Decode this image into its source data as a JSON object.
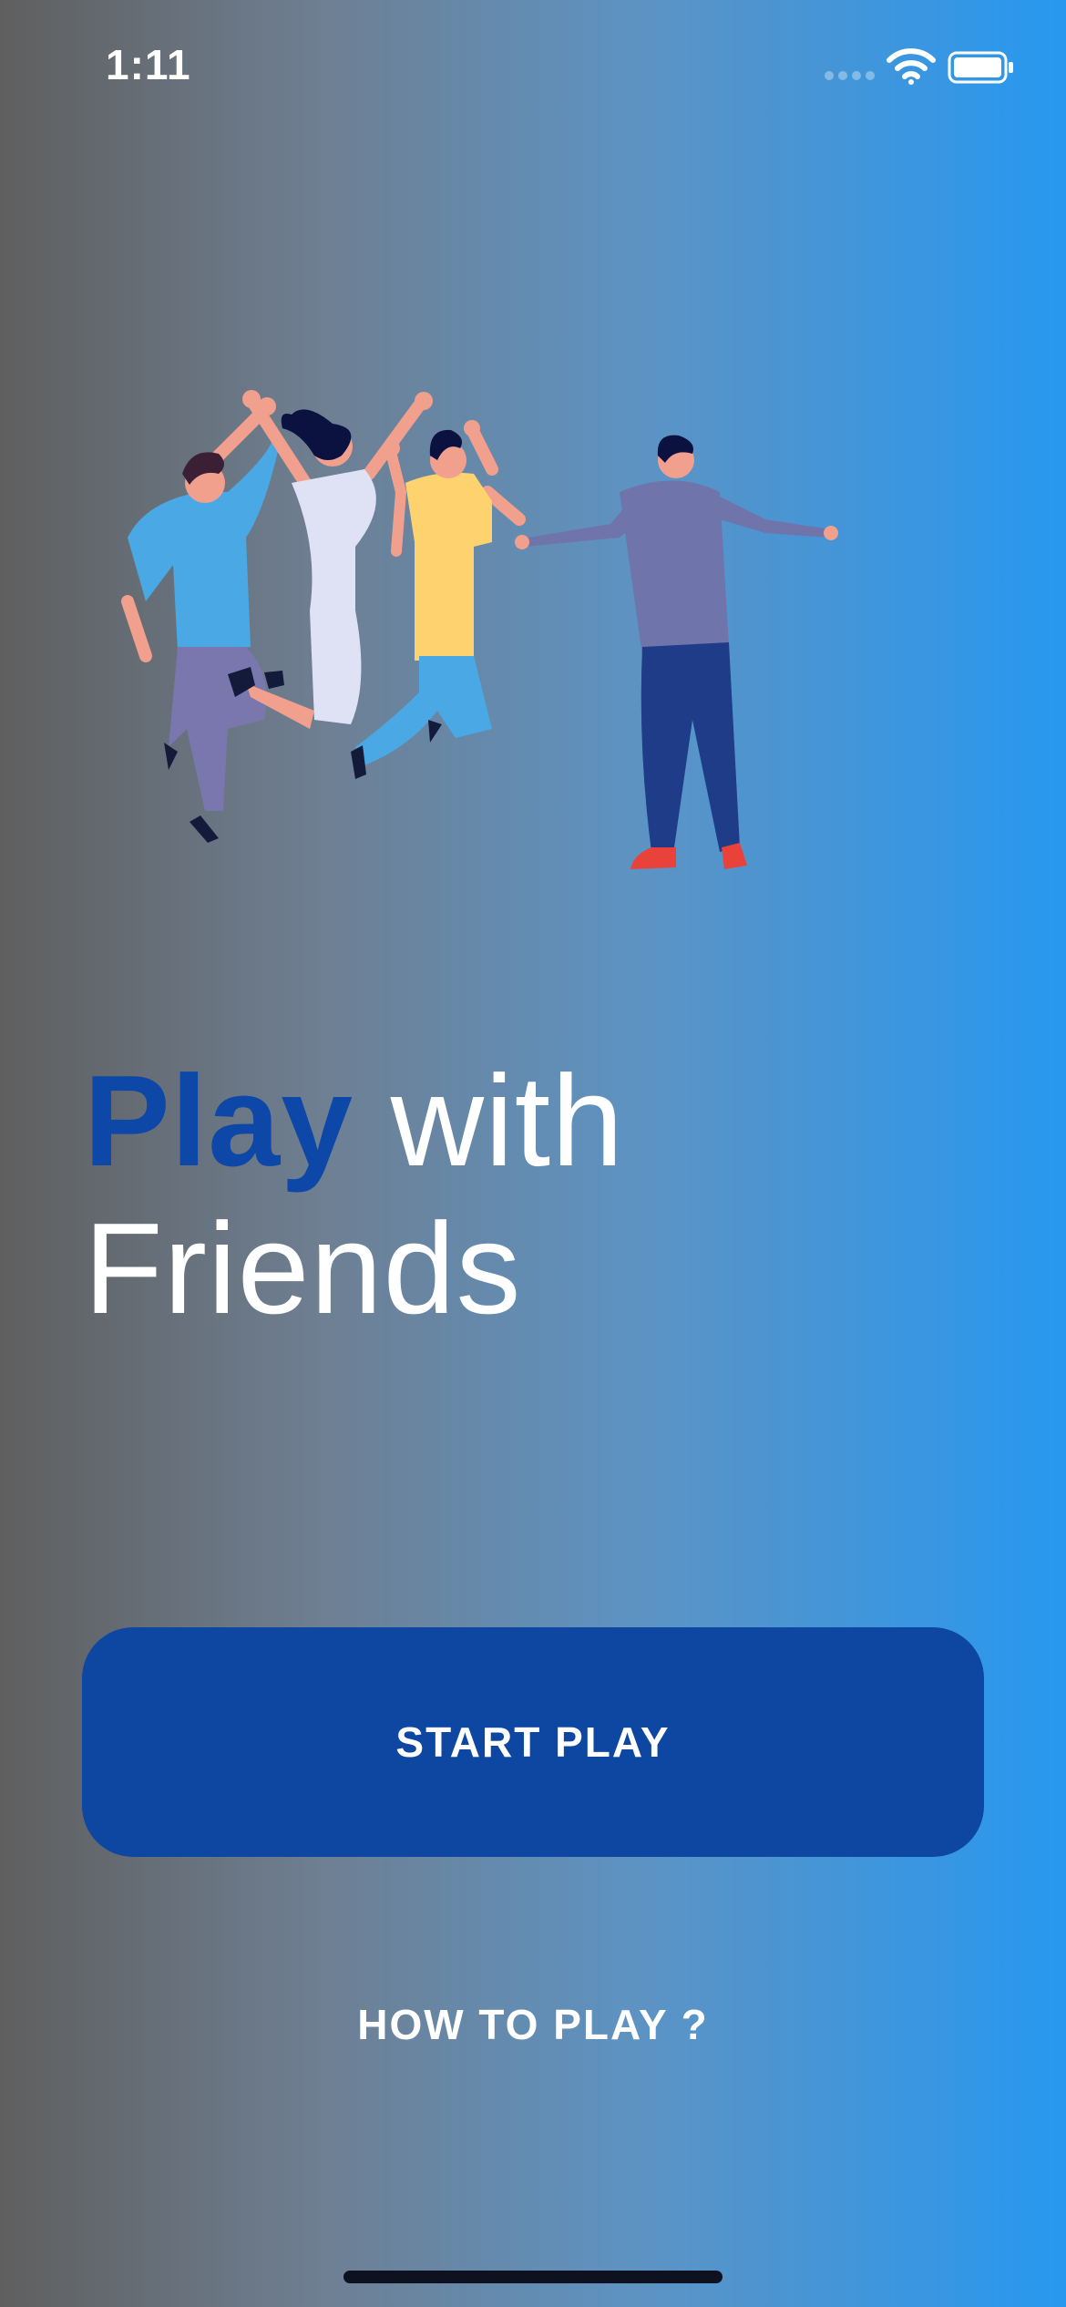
{
  "status_bar": {
    "time": "1:11",
    "icons": [
      "signal-dots-icon",
      "wifi-icon",
      "battery-icon"
    ]
  },
  "illustration": {
    "icon": "friends-jumping-illustration",
    "colors": {
      "person1_shirt": "#4aa9e4",
      "person2_dress": "#dfe2f5",
      "person3_shirt": "#fdd26f",
      "person4_shirt": "#6f74aa",
      "person4_pants": "#1f3c88",
      "skin": "#f2a08e",
      "hair": "#141a3a",
      "shoes_red": "#e9423a"
    }
  },
  "headline": {
    "accent_word": "Play",
    "line1_rest": " with",
    "line2": "Friends"
  },
  "actions": {
    "start_label": "START PLAY",
    "howto_label": "HOW TO PLAY ?"
  },
  "colors": {
    "primary": "#0d47a1",
    "gradient_start": "#5f5f5f",
    "gradient_end": "#2798f0",
    "text": "#ffffff"
  }
}
